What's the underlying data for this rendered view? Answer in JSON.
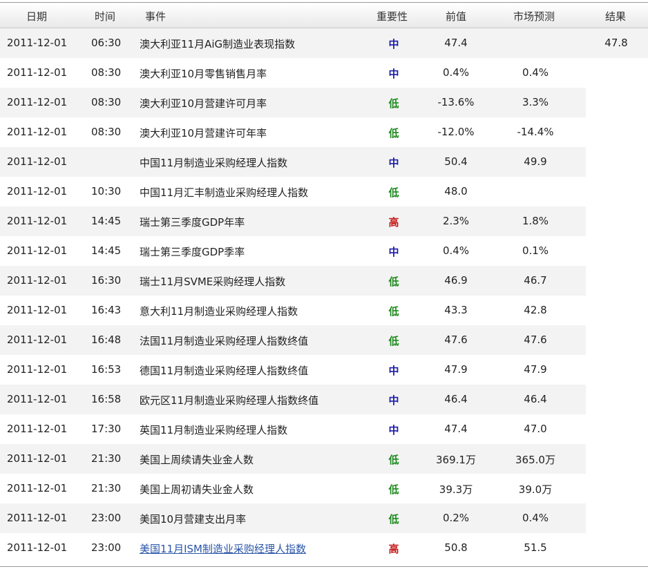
{
  "header": {
    "date": "日期",
    "time": "时间",
    "event": "事件",
    "importance": "重要性",
    "previous": "前值",
    "forecast": "市场预测",
    "result": "结果"
  },
  "colors": {
    "mid": "#1b1ba8",
    "low": "#1f8a1f",
    "high": "#c41818",
    "link": "#2a55a8"
  },
  "rows": [
    {
      "date": "2011-12-01",
      "time": "06:30",
      "event": "澳大利亚11月AiG制造业表现指数",
      "importance": "中",
      "previous": "47.4",
      "forecast": "",
      "result": "47.8"
    },
    {
      "date": "2011-12-01",
      "time": "08:30",
      "event": "澳大利亚10月零售销售月率",
      "importance": "中",
      "previous": "0.4%",
      "forecast": "0.4%",
      "result": ""
    },
    {
      "date": "2011-12-01",
      "time": "08:30",
      "event": "澳大利亚10月营建许可月率",
      "importance": "低",
      "previous": "-13.6%",
      "forecast": "3.3%",
      "result": ""
    },
    {
      "date": "2011-12-01",
      "time": "08:30",
      "event": "澳大利亚10月营建许可年率",
      "importance": "低",
      "previous": "-12.0%",
      "forecast": "-14.4%",
      "result": ""
    },
    {
      "date": "2011-12-01",
      "time": "",
      "event": "中国11月制造业采购经理人指数",
      "importance": "中",
      "previous": "50.4",
      "forecast": "49.9",
      "result": ""
    },
    {
      "date": "2011-12-01",
      "time": "10:30",
      "event": "中国11月汇丰制造业采购经理人指数",
      "importance": "低",
      "previous": "48.0",
      "forecast": "",
      "result": ""
    },
    {
      "date": "2011-12-01",
      "time": "14:45",
      "event": "瑞士第三季度GDP年率",
      "importance": "高",
      "previous": "2.3%",
      "forecast": "1.8%",
      "result": ""
    },
    {
      "date": "2011-12-01",
      "time": "14:45",
      "event": "瑞士第三季度GDP季率",
      "importance": "中",
      "previous": "0.4%",
      "forecast": "0.1%",
      "result": ""
    },
    {
      "date": "2011-12-01",
      "time": "16:30",
      "event": "瑞士11月SVME采购经理人指数",
      "importance": "低",
      "previous": "46.9",
      "forecast": "46.7",
      "result": ""
    },
    {
      "date": "2011-12-01",
      "time": "16:43",
      "event": "意大利11月制造业采购经理人指数",
      "importance": "低",
      "previous": "43.3",
      "forecast": "42.8",
      "result": ""
    },
    {
      "date": "2011-12-01",
      "time": "16:48",
      "event": "法国11月制造业采购经理人指数终值",
      "importance": "低",
      "previous": "47.6",
      "forecast": "47.6",
      "result": ""
    },
    {
      "date": "2011-12-01",
      "time": "16:53",
      "event": "德国11月制造业采购经理人指数终值",
      "importance": "中",
      "previous": "47.9",
      "forecast": "47.9",
      "result": ""
    },
    {
      "date": "2011-12-01",
      "time": "16:58",
      "event": "欧元区11月制造业采购经理人指数终值",
      "importance": "中",
      "previous": "46.4",
      "forecast": "46.4",
      "result": ""
    },
    {
      "date": "2011-12-01",
      "time": "17:30",
      "event": "英国11月制造业采购经理人指数",
      "importance": "中",
      "previous": "47.4",
      "forecast": "47.0",
      "result": ""
    },
    {
      "date": "2011-12-01",
      "time": "21:30",
      "event": "美国上周续请失业金人数",
      "importance": "低",
      "previous": "369.1万",
      "forecast": "365.0万",
      "result": ""
    },
    {
      "date": "2011-12-01",
      "time": "21:30",
      "event": "美国上周初请失业金人数",
      "importance": "低",
      "previous": "39.3万",
      "forecast": "39.0万",
      "result": ""
    },
    {
      "date": "2011-12-01",
      "time": "23:00",
      "event": "美国10月营建支出月率",
      "importance": "低",
      "previous": "0.2%",
      "forecast": "0.4%",
      "result": ""
    },
    {
      "date": "2011-12-01",
      "time": "23:00",
      "event": "美国11月ISM制造业采购经理人指数",
      "importance": "高",
      "previous": "50.8",
      "forecast": "51.5",
      "result": "",
      "is_link": true
    }
  ]
}
